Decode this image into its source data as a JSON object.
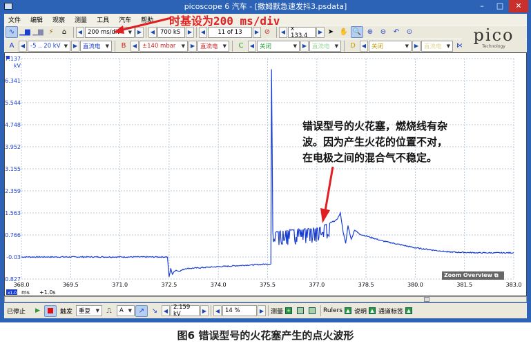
{
  "window": {
    "title": "picoscope 6 汽车 - [撒姆默急速发抖3.psdata]",
    "minimize": "–",
    "maximize": "□",
    "close": "✕"
  },
  "menu": [
    "文件",
    "编辑",
    "观察",
    "测量",
    "工具",
    "汽车",
    "帮助"
  ],
  "annotation_timebase": "时基设为200 ms/div",
  "toolbar1": {
    "timebase": "200 ms/div",
    "samples": "700 kS",
    "buffer": "11 of 13",
    "zoom": "x 133.4"
  },
  "channels": [
    {
      "letter": "A",
      "range": "-5 .. 20 kV",
      "coupling": "直流电",
      "color": "#1a3fd0"
    },
    {
      "letter": "B",
      "range": "±140 mbar",
      "coupling": "直流电",
      "color": "#d02020"
    },
    {
      "letter": "C",
      "range": "关闭",
      "coupling": "直流电",
      "color": "#20a030"
    },
    {
      "letter": "D",
      "range": "关闭",
      "coupling": "直流电",
      "color": "#c0a000"
    }
  ],
  "logo": {
    "name": "pico",
    "sub": "Technology"
  },
  "chart_data": {
    "type": "line",
    "ylabel": "kV",
    "xlabel": "ms",
    "y_ticks": [
      "7.137",
      "6.341",
      "5.544",
      "4.748",
      "3.952",
      "3.155",
      "2.359",
      "1.563",
      "0.766",
      "-0.03",
      "-0.827"
    ],
    "x_ticks": [
      "368.0",
      "369.5",
      "371.0",
      "372.5",
      "374.0",
      "375.5",
      "377.0",
      "378.5",
      "380.0",
      "381.5",
      "383.0"
    ],
    "xlim": [
      368.0,
      383.0
    ],
    "ylim": [
      -0.827,
      7.137
    ],
    "series": [
      {
        "name": "A",
        "color": "#1a3fd0",
        "points": [
          [
            368,
            -0.03
          ],
          [
            372.45,
            -0.03
          ],
          [
            372.5,
            -0.75
          ],
          [
            372.55,
            -0.45
          ],
          [
            372.6,
            -0.65
          ],
          [
            372.7,
            -0.5
          ],
          [
            372.8,
            -0.55
          ],
          [
            373,
            -0.45
          ],
          [
            374,
            -0.38
          ],
          [
            375.6,
            -0.28
          ],
          [
            375.62,
            6.75
          ],
          [
            375.66,
            0.85
          ],
          [
            376.2,
            0.95
          ],
          [
            377.0,
            1.0
          ],
          [
            377.6,
            1.3
          ],
          [
            377.72,
            1.55
          ],
          [
            377.8,
            0.9
          ],
          [
            377.88,
            0.45
          ],
          [
            377.95,
            1.1
          ],
          [
            378.05,
            0.6
          ],
          [
            378.15,
            0.95
          ],
          [
            378.3,
            0.8
          ],
          [
            379,
            0.55
          ],
          [
            380,
            0.3
          ],
          [
            381,
            0.15
          ],
          [
            382,
            0.12
          ],
          [
            383,
            0.12
          ]
        ]
      }
    ],
    "noise_ms": [
      375.66,
      377.5
    ],
    "scale_badge": "x1.0",
    "offset": "+1.0s"
  },
  "note": [
    "错误型号的火花塞，燃烧线有杂",
    "波。因为产生火花的位置不对，",
    "在电极之间的混合气不稳定。"
  ],
  "zoom_overview": "Zoom Overview",
  "bottom": {
    "status": "已停止",
    "trigger": "触发",
    "mode": "重复",
    "channel": "A",
    "level": "2.159 kV",
    "pretrigger": "14 %",
    "measure": "测量",
    "rulers": "Rulers",
    "notes": "说明",
    "labels": "通道标签"
  },
  "caption": "图6 错误型号的火花塞产生的点火波形"
}
